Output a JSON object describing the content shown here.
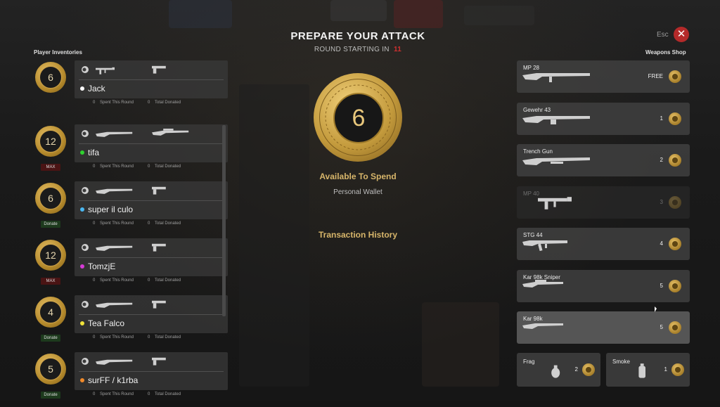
{
  "header": {
    "title": "PREPARE YOUR ATTACK",
    "round_label": "ROUND STARTING IN",
    "round_seconds": "11",
    "esc_label": "Esc",
    "close_glyph": "✕"
  },
  "left": {
    "title": "Player Inventories",
    "stat_spent_label": "Spent This Round",
    "stat_donated_label": "Total Donated",
    "players": [
      {
        "coins": "6",
        "name": "Jack",
        "dot_color": "#ffffff",
        "tag": "",
        "spent": "0",
        "donated": "0",
        "weapons": [
          "smg",
          "pistol"
        ]
      },
      {
        "coins": "12",
        "name": "tifa",
        "dot_color": "#2fd12f",
        "tag": "MAX",
        "spent": "0",
        "donated": "0",
        "weapons": [
          "rifle",
          "sniper"
        ]
      },
      {
        "coins": "6",
        "name": "super il culo",
        "dot_color": "#4ab7f0",
        "tag": "Donate",
        "spent": "0",
        "donated": "0",
        "weapons": [
          "rifle",
          "pistol"
        ]
      },
      {
        "coins": "12",
        "name": "TomzjE",
        "dot_color": "#d63bd6",
        "tag": "MAX",
        "spent": "0",
        "donated": "0",
        "weapons": [
          "rifle",
          "pistol"
        ]
      },
      {
        "coins": "4",
        "name": "Tea Falco",
        "dot_color": "#f0e23a",
        "tag": "Donate",
        "spent": "0",
        "donated": "0",
        "weapons": [
          "rifle",
          "pistol"
        ]
      },
      {
        "coins": "5",
        "name": "surFF / k1rba",
        "dot_color": "#f08a2a",
        "tag": "Donate",
        "spent": "0",
        "donated": "0",
        "weapons": [
          "rifle",
          "pistol"
        ]
      }
    ]
  },
  "center": {
    "coin_value": "6",
    "available_label": "Available To Spend",
    "wallet_label": "Personal Wallet",
    "history_label": "Transaction History"
  },
  "shop": {
    "title": "Weapons Shop",
    "weapons": [
      {
        "name": "MP 28",
        "price": "FREE",
        "state": "normal",
        "icon": "smg-long"
      },
      {
        "name": "Gewehr 43",
        "price": "1",
        "state": "normal",
        "icon": "rifle-mag"
      },
      {
        "name": "Trench Gun",
        "price": "2",
        "state": "normal",
        "icon": "shotgun"
      },
      {
        "name": "MP 40",
        "price": "3",
        "state": "disabled",
        "icon": "smg"
      },
      {
        "name": "STG 44",
        "price": "4",
        "state": "normal",
        "icon": "assault"
      },
      {
        "name": "Kar 98k Sniper",
        "price": "5",
        "state": "normal",
        "icon": "sniper"
      },
      {
        "name": "Kar 98k",
        "price": "5",
        "state": "hover",
        "icon": "rifle"
      }
    ],
    "grenades": [
      {
        "name": "Frag",
        "price": "2",
        "icon": "frag-grenade"
      },
      {
        "name": "Smoke",
        "price": "1",
        "icon": "smoke-grenade"
      }
    ]
  }
}
